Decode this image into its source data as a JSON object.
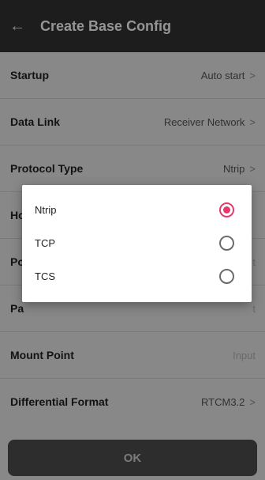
{
  "header": {
    "back_icon": "arrow-left-icon",
    "title": "Create Base Config"
  },
  "rows": [
    {
      "label": "Startup",
      "value": "Auto start",
      "chevron": true
    },
    {
      "label": "Data Link",
      "value": "Receiver Network",
      "chevron": true
    },
    {
      "label": "Protocol Type",
      "value": "Ntrip",
      "chevron": true
    },
    {
      "label": "Ho",
      "value": "",
      "chevron": false
    },
    {
      "label": "Po",
      "value": "t",
      "chevron": false
    },
    {
      "label": "Pa",
      "value": "t",
      "chevron": false
    },
    {
      "label": "Mount Point",
      "value": "Input",
      "chevron": false
    },
    {
      "label": "Differential Format",
      "value": "RTCM3.2",
      "chevron": true
    }
  ],
  "dialog": {
    "options": [
      {
        "label": "Ntrip",
        "selected": true
      },
      {
        "label": "TCP",
        "selected": false
      },
      {
        "label": "TCS",
        "selected": false
      }
    ]
  },
  "footer": {
    "ok_label": "OK"
  },
  "colors": {
    "accent": "#e8386c",
    "header_bg": "#333333",
    "marker": "#d88a17"
  }
}
